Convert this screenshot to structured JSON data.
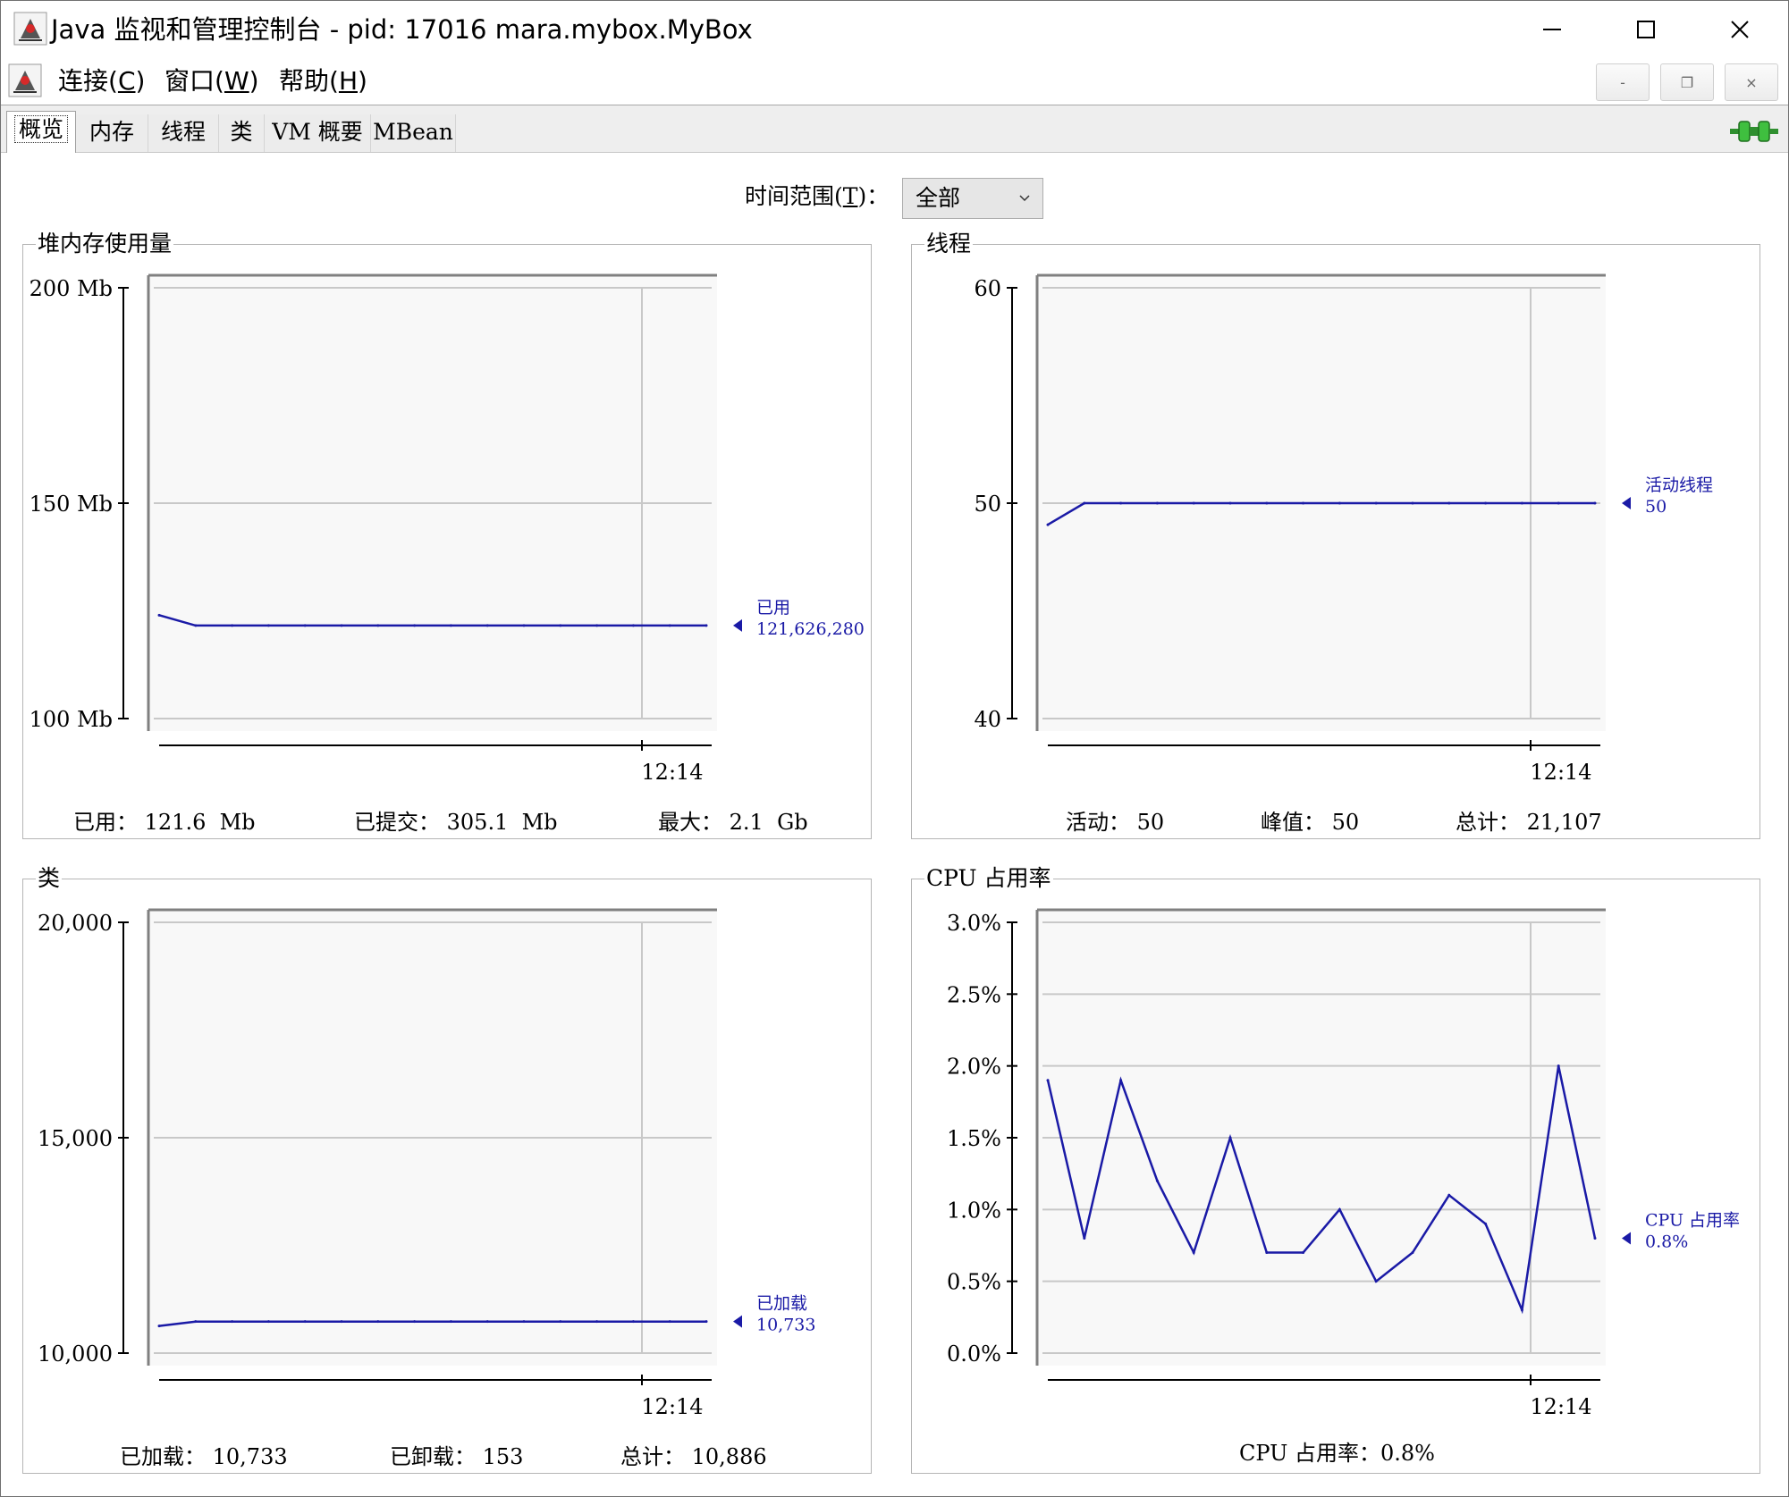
{
  "window": {
    "title": "Java 监视和管理控制台 - pid: 17016 mara.mybox.MyBox",
    "icon": "java-duke-icon",
    "controls": [
      "minimize-icon",
      "maximize-icon",
      "close-icon"
    ]
  },
  "menu": {
    "items": [
      {
        "name": "menu-connect",
        "text": "连接(",
        "mnemonic": "C",
        "close": ")"
      },
      {
        "name": "menu-window",
        "text": "窗口(",
        "mnemonic": "W",
        "close": ")"
      },
      {
        "name": "menu-help",
        "text": "帮助(",
        "mnemonic": "H",
        "close": ")"
      }
    ],
    "mdi_controls": [
      "-",
      "❐",
      "×"
    ]
  },
  "tabs": [
    "概览",
    "内存",
    "线程",
    "类",
    "VM 概要",
    "MBean"
  ],
  "active_tab": 0,
  "status_icon": "connection-plug-icon",
  "time_range": {
    "label": "时间范围(",
    "mnemonic": "T",
    "label_close": ")：",
    "value": "全部"
  },
  "panels": {
    "heap": {
      "title": "堆内存使用量",
      "summary": [
        {
          "label": "已用：",
          "value": "121.6  Mb"
        },
        {
          "label": "已提交：",
          "value": "305.1  Mb"
        },
        {
          "label": "最大：",
          "value": "2.1  Gb"
        }
      ]
    },
    "threads": {
      "title": "线程",
      "summary": [
        {
          "label": "活动：",
          "value": "50"
        },
        {
          "label": "峰值：",
          "value": "50"
        },
        {
          "label": "总计：",
          "value": "21,107"
        }
      ]
    },
    "classes": {
      "title": "类",
      "summary": [
        {
          "label": "已加载：",
          "value": "10,733"
        },
        {
          "label": "已卸载：",
          "value": "153"
        },
        {
          "label": "总计：",
          "value": "10,886"
        }
      ]
    },
    "cpu": {
      "title": "CPU 占用率",
      "summary": [
        {
          "label": "CPU 占用率：",
          "value": "0.8%"
        }
      ]
    }
  },
  "chart_data": [
    {
      "type": "line",
      "title": "堆内存使用量",
      "ylim": [
        100,
        200
      ],
      "y_ticks": [
        100,
        150,
        200
      ],
      "y_tick_labels": [
        "100 Mb",
        "150 Mb",
        "200 Mb"
      ],
      "x_tick_labels": [
        "12:14"
      ],
      "grid": true,
      "series": [
        {
          "name": "已用",
          "current_label": "121,626,280",
          "values": [
            124,
            121.6,
            121.6,
            121.6,
            121.6,
            121.6,
            121.6,
            121.6,
            121.6,
            121.6,
            121.6,
            121.6,
            121.6,
            121.6,
            121.6,
            121.6
          ]
        }
      ],
      "color": "#1a1aa6"
    },
    {
      "type": "line",
      "title": "线程",
      "ylim": [
        40,
        60
      ],
      "y_ticks": [
        40,
        50,
        60
      ],
      "y_tick_labels": [
        "40",
        "50",
        "60"
      ],
      "x_tick_labels": [
        "12:14"
      ],
      "grid": true,
      "series": [
        {
          "name": "活动线程",
          "current_label": "50",
          "values": [
            49,
            50,
            50,
            50,
            50,
            50,
            50,
            50,
            50,
            50,
            50,
            50,
            50,
            50,
            50,
            50
          ]
        }
      ],
      "color": "#1a1aa6"
    },
    {
      "type": "line",
      "title": "类",
      "ylim": [
        10000,
        20000
      ],
      "y_ticks": [
        10000,
        15000,
        20000
      ],
      "y_tick_labels": [
        "10,000",
        "15,000",
        "20,000"
      ],
      "x_tick_labels": [
        "12:14"
      ],
      "grid": true,
      "series": [
        {
          "name": "已加载",
          "current_label": "10,733",
          "values": [
            10630,
            10733,
            10733,
            10733,
            10733,
            10733,
            10733,
            10733,
            10733,
            10733,
            10733,
            10733,
            10733,
            10733,
            10733,
            10733
          ]
        }
      ],
      "color": "#1a1aa6"
    },
    {
      "type": "line",
      "title": "CPU 占用率",
      "ylim": [
        0,
        3
      ],
      "y_ticks": [
        0,
        0.5,
        1,
        1.5,
        2,
        2.5,
        3
      ],
      "y_tick_labels": [
        "0.0%",
        "0.5%",
        "1.0%",
        "1.5%",
        "2.0%",
        "2.5%",
        "3.0%"
      ],
      "x_tick_labels": [
        "12:14"
      ],
      "grid": true,
      "series": [
        {
          "name": "CPU 占用率",
          "current_label": "0.8%",
          "values": [
            1.9,
            0.8,
            1.9,
            1.2,
            0.7,
            1.5,
            0.7,
            0.7,
            1.0,
            0.5,
            0.7,
            1.1,
            0.9,
            0.3,
            2.0,
            0.8
          ]
        }
      ],
      "color": "#1a1aa6"
    }
  ]
}
